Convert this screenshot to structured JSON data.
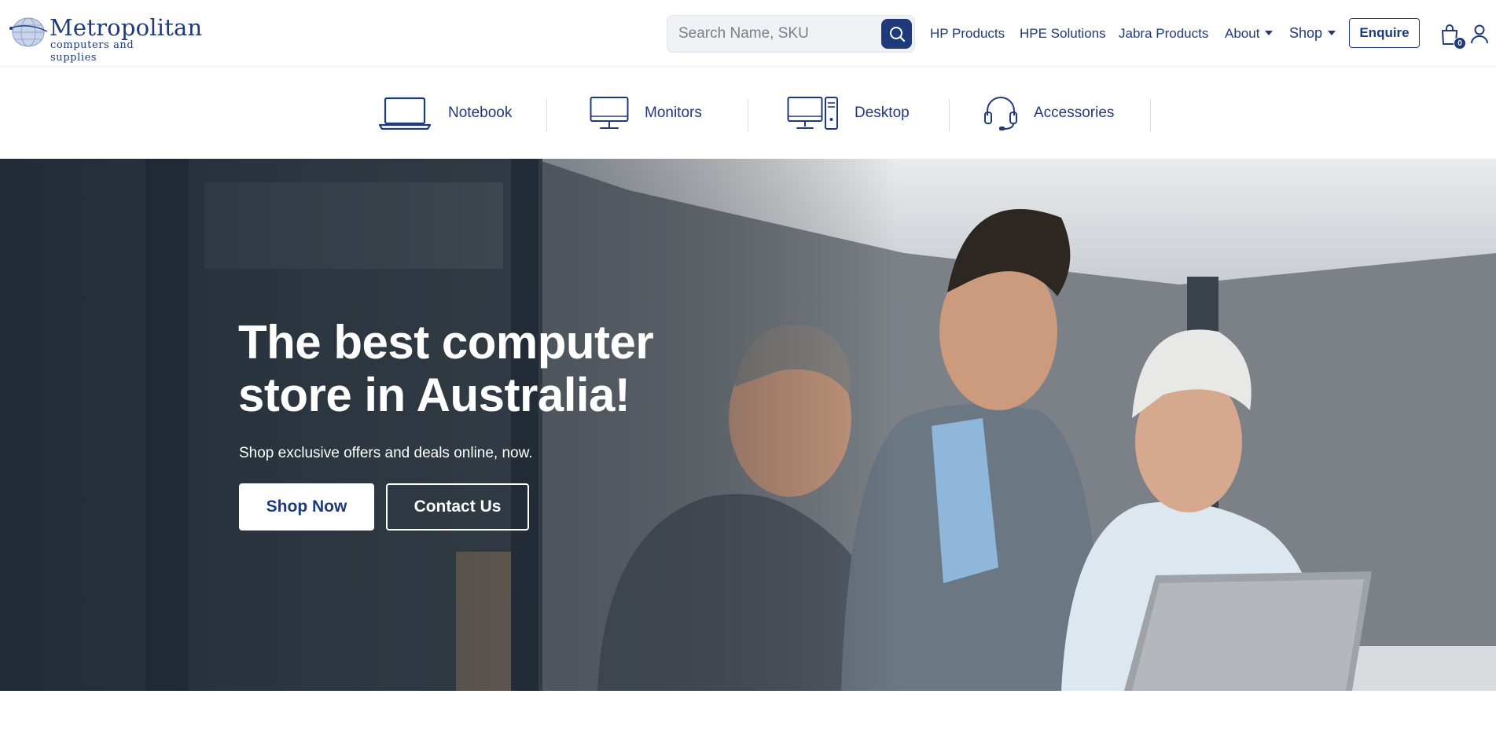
{
  "header": {
    "logo_name": "Metropolitan",
    "logo_tagline": "computers and supplies",
    "search_placeholder": "Search Name, SKU",
    "nav": {
      "hp_products": "HP Products",
      "hpe_solutions": "HPE Solutions",
      "jabra_products": "Jabra Products",
      "about": "About",
      "shop": "Shop"
    },
    "enquire_label": "Enquire",
    "cart_count": "0"
  },
  "categories": [
    {
      "label": "Notebook",
      "icon": "laptop-icon"
    },
    {
      "label": "Monitors",
      "icon": "monitor-icon"
    },
    {
      "label": "Desktop",
      "icon": "desktop-icon"
    },
    {
      "label": "Accessories",
      "icon": "headset-icon"
    }
  ],
  "hero": {
    "title_line1": "The best computer",
    "title_line2": "store in Australia!",
    "subtitle": "Shop exclusive offers and deals online, now.",
    "shop_now_label": "Shop Now",
    "contact_us_label": "Contact Us"
  },
  "colors": {
    "brand_navy": "#1f3a7a",
    "white": "#ffffff"
  }
}
